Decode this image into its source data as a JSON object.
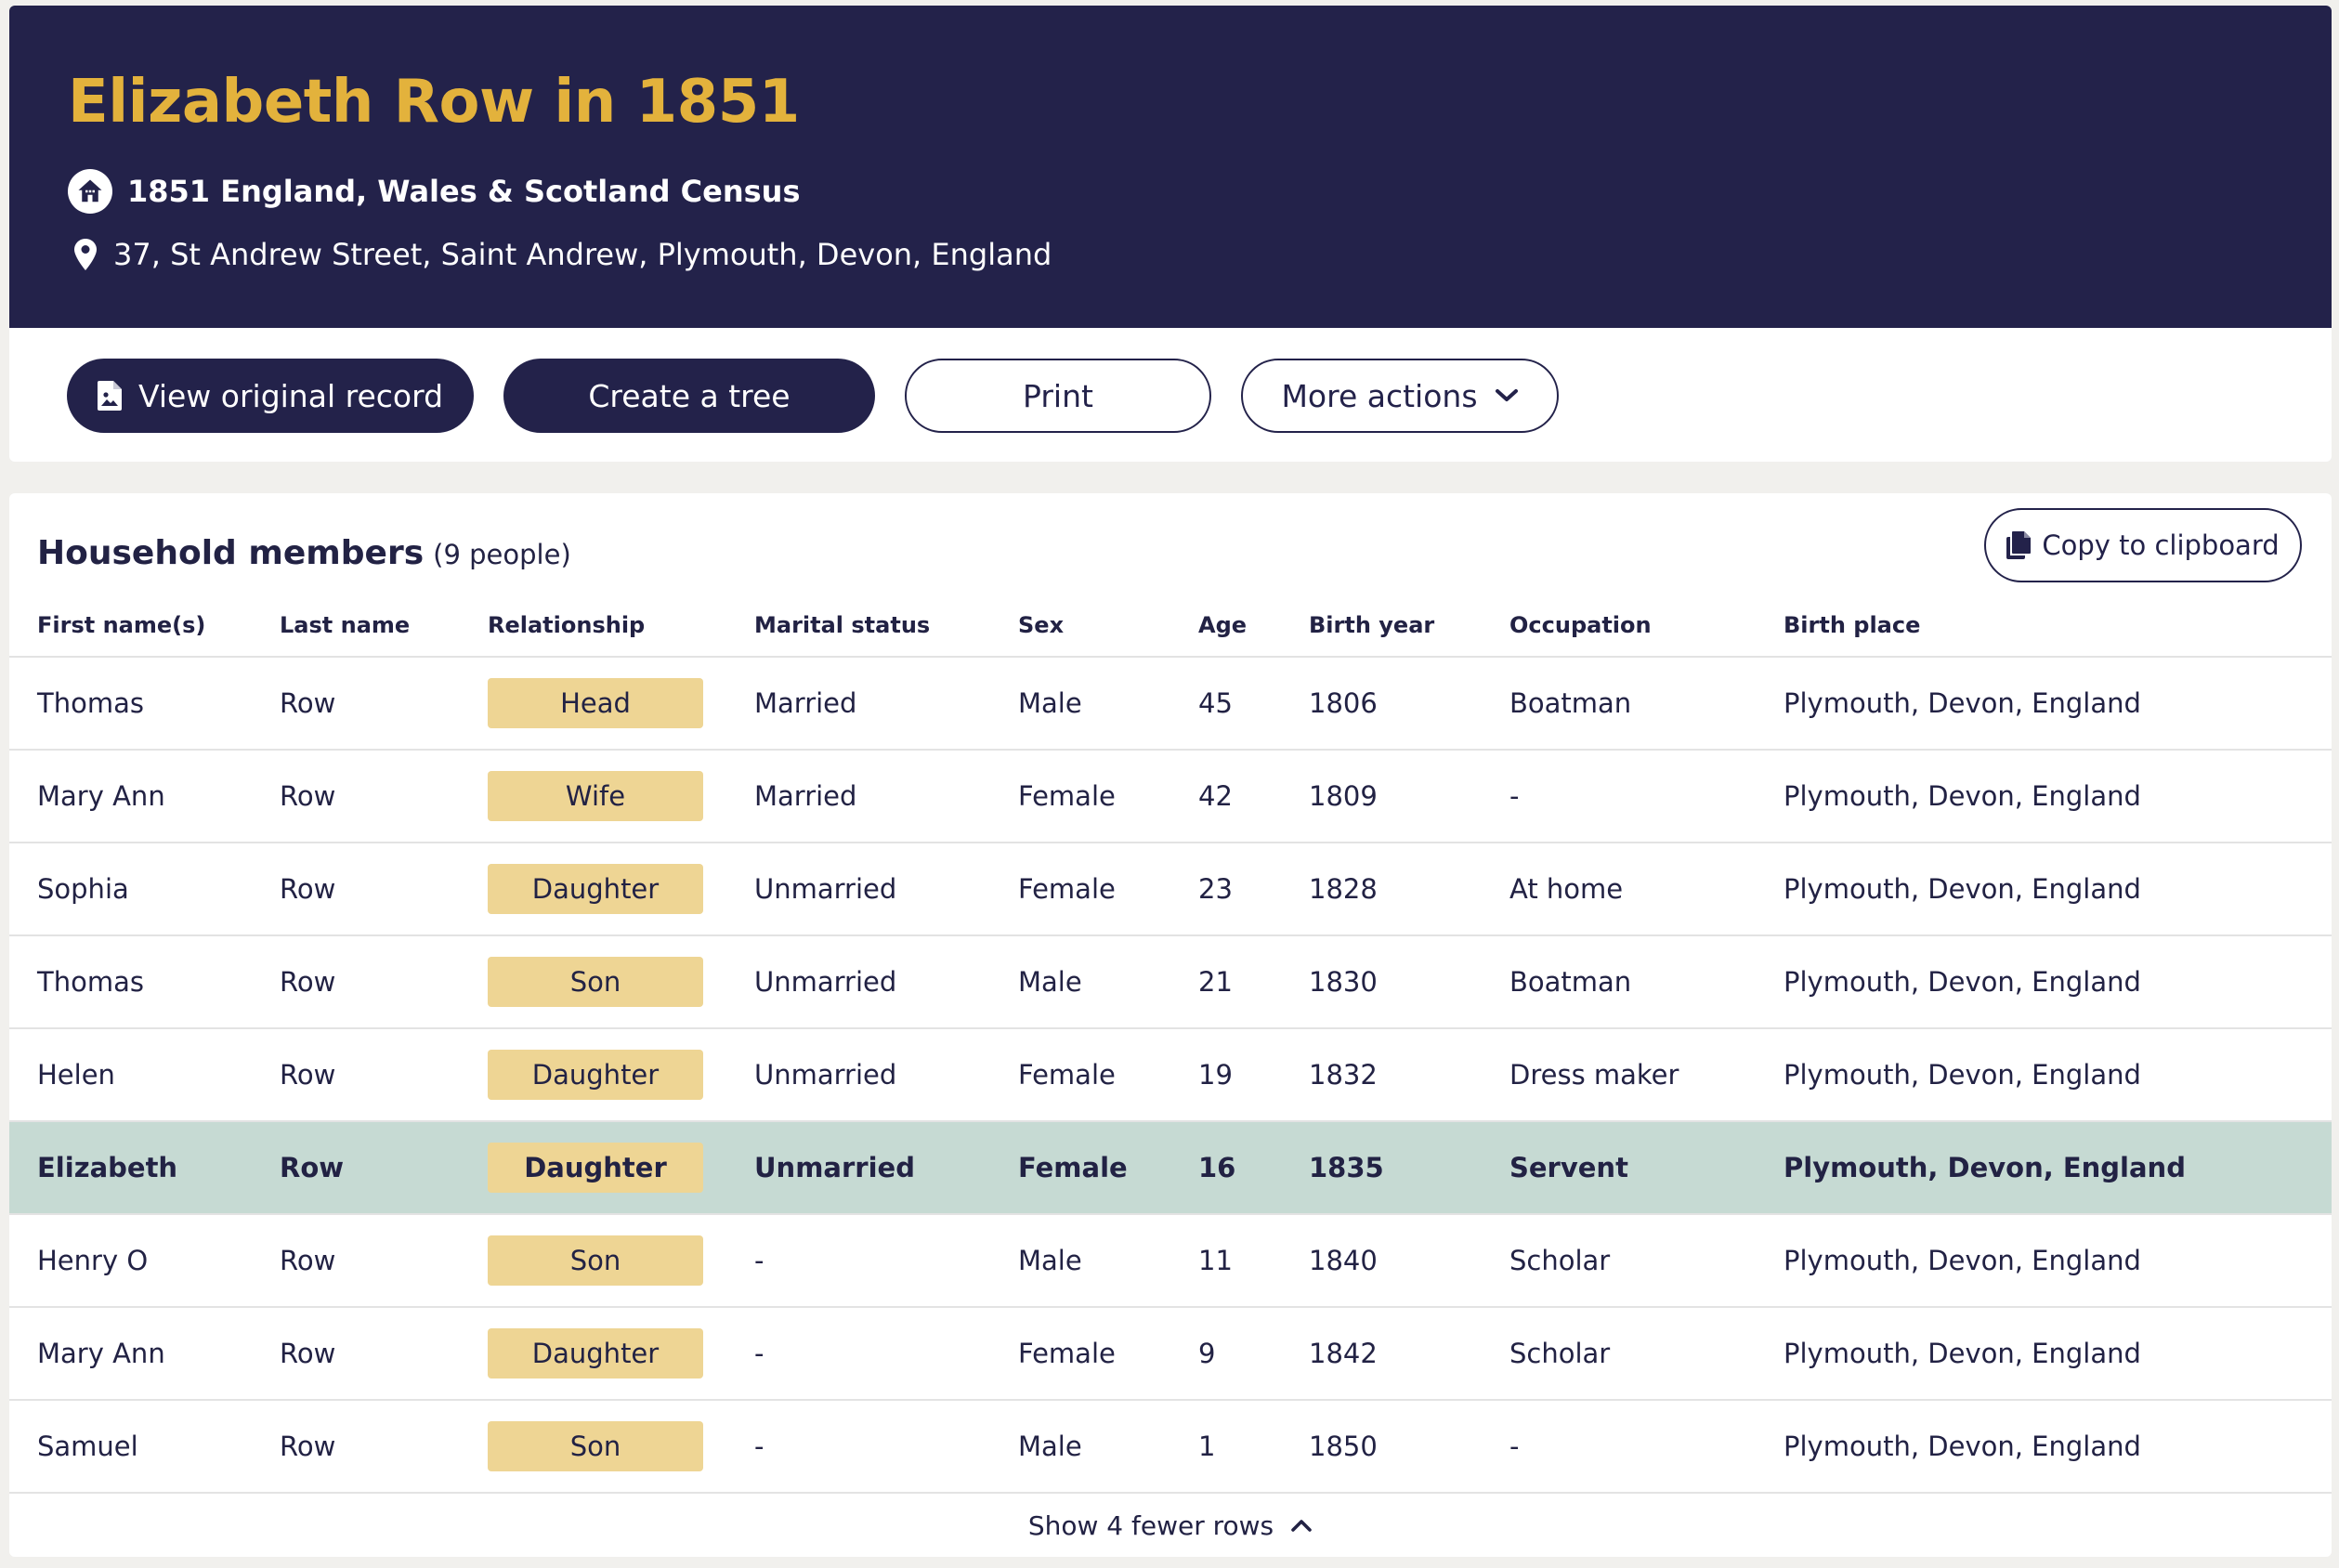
{
  "header": {
    "title": "Elizabeth Row in 1851",
    "census": "1851 England, Wales & Scotland Census",
    "address": "37, St Andrew Street, Saint Andrew, Plymouth, Devon, England",
    "icons": {
      "census": "house-icon",
      "address": "map-pin-icon"
    },
    "colors": {
      "background": "#23224a",
      "title": "#e3b23c"
    }
  },
  "actions": {
    "view_original": "View original record",
    "create_tree": "Create a tree",
    "print": "Print",
    "more_actions": "More actions",
    "icons": {
      "view_original": "document-image-icon",
      "more_actions": "chevron-down-icon"
    }
  },
  "household": {
    "title": "Household members",
    "count": "(9 people)",
    "copy_button": "Copy to clipboard",
    "copy_icon": "clipboard-copy-icon",
    "columns": [
      "First name(s)",
      "Last name",
      "Relationship",
      "Marital status",
      "Sex",
      "Age",
      "Birth year",
      "Occupation",
      "Birth place"
    ],
    "rows": [
      {
        "first": "Thomas",
        "last": "Row",
        "relationship": "Head",
        "marital": "Married",
        "sex": "Male",
        "age": "45",
        "birth_year": "1806",
        "occupation": "Boatman",
        "birth_place": "Plymouth, Devon, England",
        "highlighted": false
      },
      {
        "first": "Mary Ann",
        "last": "Row",
        "relationship": "Wife",
        "marital": "Married",
        "sex": "Female",
        "age": "42",
        "birth_year": "1809",
        "occupation": "-",
        "birth_place": "Plymouth, Devon, England",
        "highlighted": false
      },
      {
        "first": "Sophia",
        "last": "Row",
        "relationship": "Daughter",
        "marital": "Unmarried",
        "sex": "Female",
        "age": "23",
        "birth_year": "1828",
        "occupation": "At home",
        "birth_place": "Plymouth, Devon, England",
        "highlighted": false
      },
      {
        "first": "Thomas",
        "last": "Row",
        "relationship": "Son",
        "marital": "Unmarried",
        "sex": "Male",
        "age": "21",
        "birth_year": "1830",
        "occupation": "Boatman",
        "birth_place": "Plymouth, Devon, England",
        "highlighted": false
      },
      {
        "first": "Helen",
        "last": "Row",
        "relationship": "Daughter",
        "marital": "Unmarried",
        "sex": "Female",
        "age": "19",
        "birth_year": "1832",
        "occupation": "Dress maker",
        "birth_place": "Plymouth, Devon, England",
        "highlighted": false
      },
      {
        "first": "Elizabeth",
        "last": "Row",
        "relationship": "Daughter",
        "marital": "Unmarried",
        "sex": "Female",
        "age": "16",
        "birth_year": "1835",
        "occupation": "Servent",
        "birth_place": "Plymouth, Devon, England",
        "highlighted": true
      },
      {
        "first": "Henry O",
        "last": "Row",
        "relationship": "Son",
        "marital": "-",
        "sex": "Male",
        "age": "11",
        "birth_year": "1840",
        "occupation": "Scholar",
        "birth_place": "Plymouth, Devon, England",
        "highlighted": false
      },
      {
        "first": "Mary Ann",
        "last": "Row",
        "relationship": "Daughter",
        "marital": "-",
        "sex": "Female",
        "age": "9",
        "birth_year": "1842",
        "occupation": "Scholar",
        "birth_place": "Plymouth, Devon, England",
        "highlighted": false
      },
      {
        "first": "Samuel",
        "last": "Row",
        "relationship": "Son",
        "marital": "-",
        "sex": "Male",
        "age": "1",
        "birth_year": "1850",
        "occupation": "-",
        "birth_place": "Plymouth, Devon, England",
        "highlighted": false
      }
    ],
    "show_fewer": "Show 4 fewer rows",
    "show_fewer_icon": "chevron-up-icon",
    "colors": {
      "relationship_pill": "#eed594",
      "highlight_row": "#c6dad3"
    }
  }
}
